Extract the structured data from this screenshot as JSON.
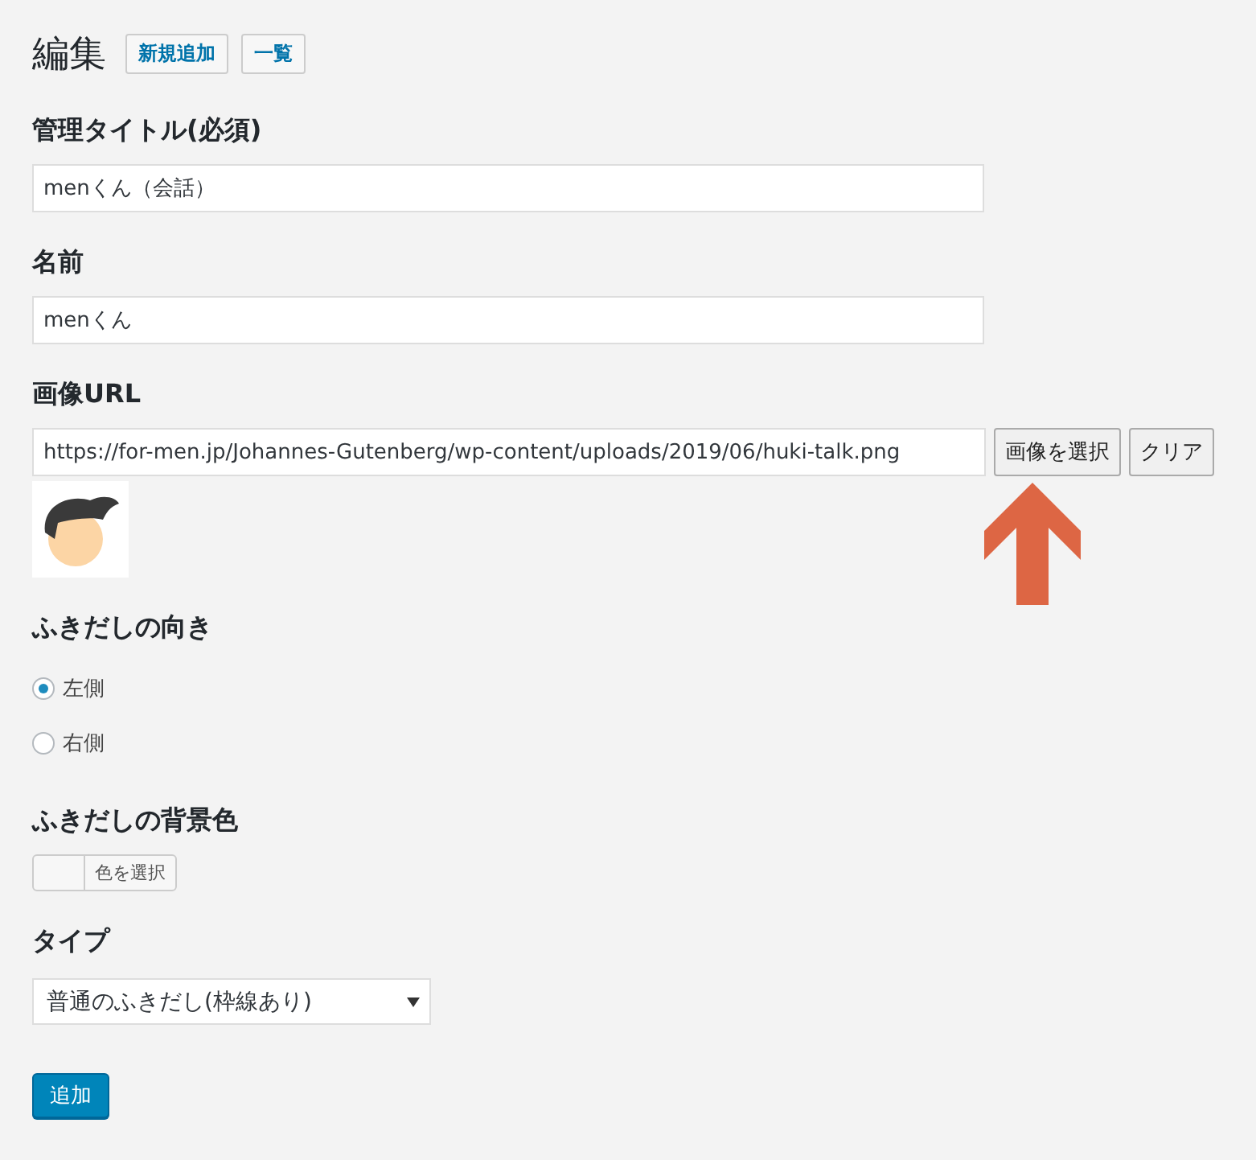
{
  "header": {
    "title": "編集",
    "buttons": [
      "新規追加",
      "一覧"
    ]
  },
  "fields": [
    {
      "label": "管理タイトル(必須)",
      "value": "menくん（会話）"
    },
    {
      "label": "名前",
      "value": "menくん"
    }
  ],
  "image_url": {
    "label": "画像URL",
    "value": "https://for-men.jp/Johannes-Gutenberg/wp-content/uploads/2019/06/huki-talk.png",
    "buttons": [
      "画像を選択",
      "クリア"
    ]
  },
  "direction": {
    "label": "ふきだしの向き",
    "options": [
      {
        "label": "左側",
        "selected": true
      },
      {
        "label": "右側",
        "selected": false
      }
    ]
  },
  "background": {
    "label": "ふきだしの背景色",
    "button": "色を選択"
  },
  "type": {
    "label": "タイプ",
    "value": "普通のふきだし(枠線あり)"
  },
  "submit": "追加"
}
